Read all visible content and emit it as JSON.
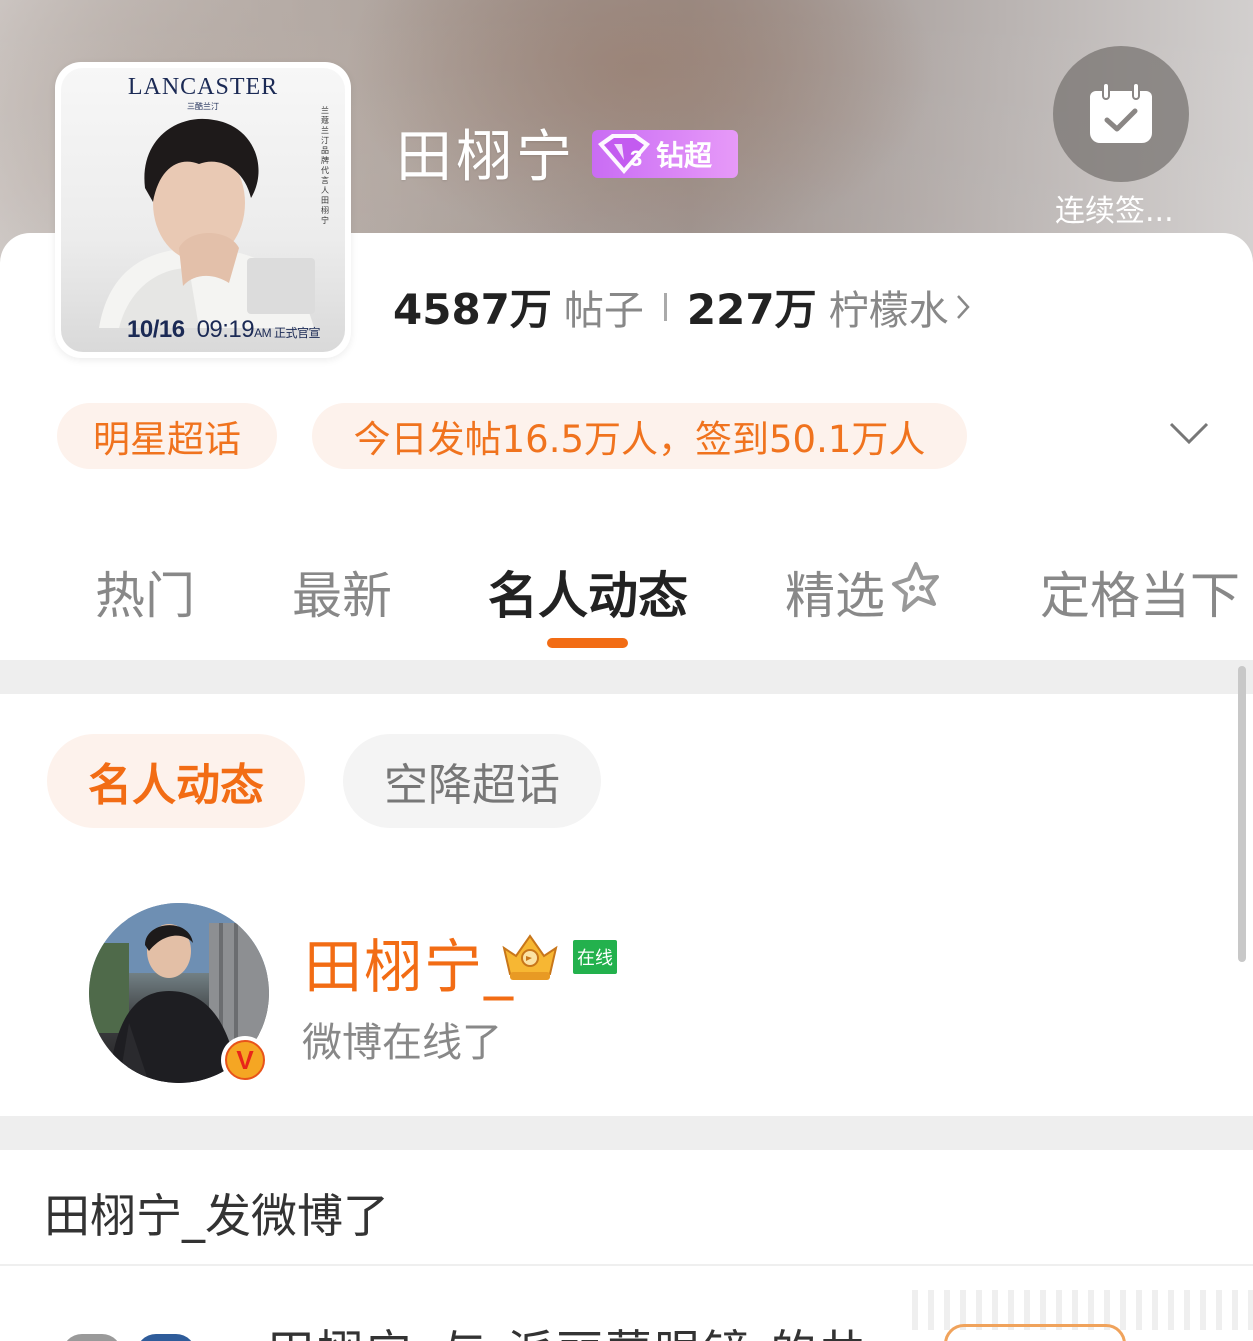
{
  "header": {
    "title": "田栩宁",
    "badge_label": "钻超",
    "checkin_label": "连续签..."
  },
  "cover": {
    "brand": "LANCASTER",
    "date": "10/16",
    "time": "09:19",
    "time_suffix": "AM 正式官宣"
  },
  "stats": {
    "posts_count": "4587万",
    "posts_label": "帖子",
    "fans_count": "227万",
    "fans_label": "柠檬水"
  },
  "chips": {
    "category": "明星超话",
    "activity": "今日发帖16.5万人，签到50.1万人"
  },
  "tabs": [
    {
      "label": "热门"
    },
    {
      "label": "最新"
    },
    {
      "label": "名人动态"
    },
    {
      "label": "精选"
    },
    {
      "label": "定格当下"
    }
  ],
  "active_tab_index": 2,
  "sub_tabs": [
    {
      "label": "名人动态"
    },
    {
      "label": "空降超话"
    }
  ],
  "user": {
    "name": "田栩宁_",
    "online_badge": "在线",
    "status": "微博在线了",
    "verified_mark": "V"
  },
  "post": {
    "heading": "田栩宁_发微博了",
    "peek_text": "田栩宁_与 派丽蒙眼镜 的共"
  },
  "colors": {
    "accent": "#f26c14",
    "chip_bg": "#fdf2ec",
    "badge_purple": "#d37cf6",
    "online_green": "#23b14d"
  }
}
